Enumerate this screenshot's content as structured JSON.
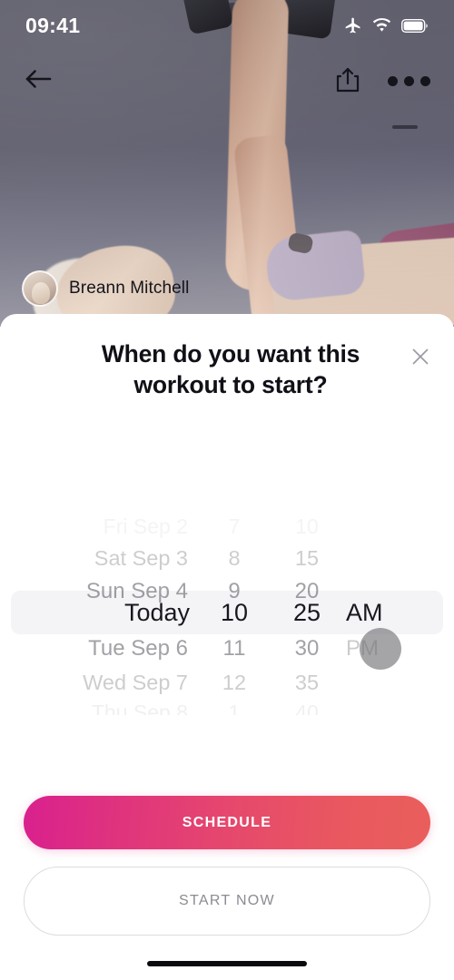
{
  "status_bar": {
    "time": "09:41",
    "icons": [
      "airplane-icon",
      "wifi-icon",
      "battery-icon"
    ]
  },
  "nav_bar": {
    "back_icon": "arrow-left-icon",
    "share_icon": "share-icon",
    "more_icon": "more-dots-icon"
  },
  "hero": {
    "author_name": "Breann Mitchell",
    "avatar": "user-avatar"
  },
  "sheet": {
    "title": "When do you want this workout to start?",
    "close_icon": "close-icon"
  },
  "picker": {
    "rows": [
      {
        "date": "Fri Sep 2",
        "hour": "7",
        "minute": "10",
        "meridiem": ""
      },
      {
        "date": "Sat Sep 3",
        "hour": "8",
        "minute": "15",
        "meridiem": ""
      },
      {
        "date": "Sun Sep 4",
        "hour": "9",
        "minute": "20",
        "meridiem": ""
      },
      {
        "date": "Today",
        "hour": "10",
        "minute": "25",
        "meridiem": "AM"
      },
      {
        "date": "Tue Sep 6",
        "hour": "11",
        "minute": "30",
        "meridiem": "PM"
      },
      {
        "date": "Wed Sep 7",
        "hour": "12",
        "minute": "35",
        "meridiem": ""
      },
      {
        "date": "Thu Sep 8",
        "hour": "1",
        "minute": "40",
        "meridiem": ""
      }
    ],
    "selected": {
      "date": "Today",
      "hour": "10",
      "minute": "25",
      "meridiem": "AM"
    }
  },
  "actions": {
    "schedule_label": "SCHEDULE",
    "start_now_label": "START NOW"
  },
  "colors": {
    "gradient_start": "#d9208e",
    "gradient_end": "#e95f5c",
    "selected_row_bg": "#f4f4f6",
    "text_primary": "#18181f",
    "text_muted": "#8b8b93"
  }
}
